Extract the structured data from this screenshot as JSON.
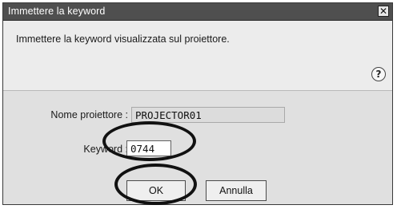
{
  "dialog": {
    "title": "Immettere la keyword",
    "close_glyph": "✕",
    "instruction": "Immettere la keyword visualizzata sul proiettore.",
    "help_glyph": "?"
  },
  "form": {
    "projector_name_label": "Nome proiettore :",
    "projector_name_value": "PROJECTOR01",
    "keyword_label": "Keyword :",
    "keyword_value": "0744"
  },
  "buttons": {
    "ok_label": "OK",
    "cancel_label": "Annulla"
  },
  "icons": {
    "close": "close-icon",
    "help": "help-icon"
  },
  "colors": {
    "titlebar": "#4f4f4f",
    "highlight": "#111111"
  }
}
